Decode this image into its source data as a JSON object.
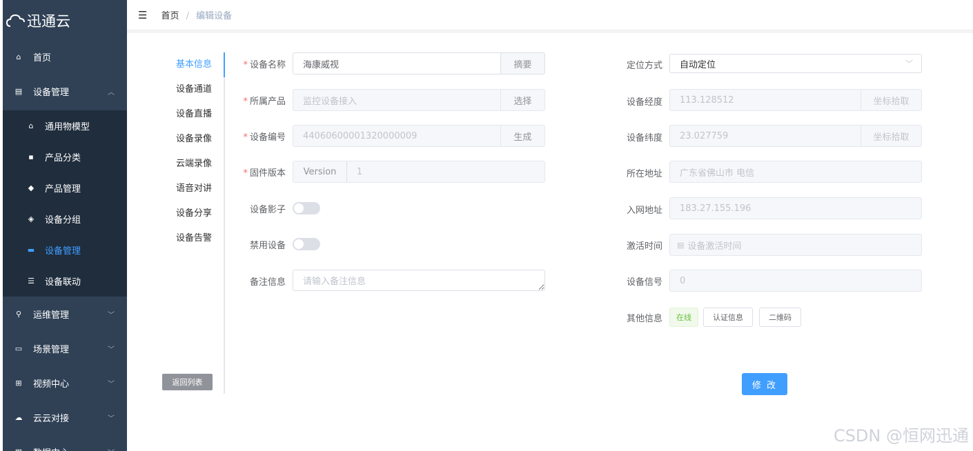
{
  "app": {
    "logo_text": "迅通云"
  },
  "sidebar": {
    "items": [
      {
        "label": "首页",
        "icon": "home-icon"
      },
      {
        "label": "设备管理",
        "icon": "device-icon",
        "expanded": true
      },
      {
        "label": "运维管理",
        "icon": "ops-icon"
      },
      {
        "label": "场景管理",
        "icon": "scene-icon"
      },
      {
        "label": "视频中心",
        "icon": "video-icon"
      },
      {
        "label": "云云对接",
        "icon": "cloud-icon"
      },
      {
        "label": "数据中心",
        "icon": "data-icon"
      }
    ],
    "subitems": [
      {
        "label": "通用物模型",
        "icon": "model-icon"
      },
      {
        "label": "产品分类",
        "icon": "category-icon"
      },
      {
        "label": "产品管理",
        "icon": "product-icon"
      },
      {
        "label": "设备分组",
        "icon": "group-icon"
      },
      {
        "label": "设备管理",
        "icon": "device-manage-icon",
        "active": true
      },
      {
        "label": "设备联动",
        "icon": "linkage-icon"
      }
    ]
  },
  "breadcrumb": {
    "home": "首页",
    "separator": "/",
    "current": "编辑设备"
  },
  "tabs": [
    "基本信息",
    "设备通道",
    "设备直播",
    "设备录像",
    "云端录像",
    "语音对讲",
    "设备分享",
    "设备告警"
  ],
  "back_button": "返回列表",
  "form": {
    "device_name": {
      "label": "设备名称",
      "value": "海康威视",
      "append": "摘要",
      "required": true
    },
    "product": {
      "label": "所属产品",
      "placeholder": "监控设备接入",
      "append": "选择",
      "required": true
    },
    "device_number": {
      "label": "设备编号",
      "value": "44060600001320000009",
      "append": "生成",
      "required": true
    },
    "firmware": {
      "label": "固件版本",
      "prepend": "Version",
      "value": "1",
      "required": true
    },
    "shadow": {
      "label": "设备影子"
    },
    "disable": {
      "label": "禁用设备"
    },
    "remark": {
      "label": "备注信息",
      "placeholder": "请输入备注信息"
    },
    "location_mode": {
      "label": "定位方式",
      "value": "自动定位"
    },
    "longitude": {
      "label": "设备经度",
      "value": "113.128512",
      "append": "坐标拾取"
    },
    "latitude": {
      "label": "设备纬度",
      "value": "23.027759",
      "append": "坐标拾取"
    },
    "address": {
      "label": "所在地址",
      "value": "广东省佛山市 电信"
    },
    "network_address": {
      "label": "入网地址",
      "value": "183.27.155.196"
    },
    "activation_time": {
      "label": "激活时间",
      "placeholder": "设备激活时间"
    },
    "signal": {
      "label": "设备信号",
      "value": "0"
    },
    "other_info": {
      "label": "其他信息",
      "status": "在线",
      "auth_button": "认证信息",
      "qrcode_button": "二维码"
    }
  },
  "submit_button": "修 改",
  "watermark": "CSDN @恒网迅通"
}
